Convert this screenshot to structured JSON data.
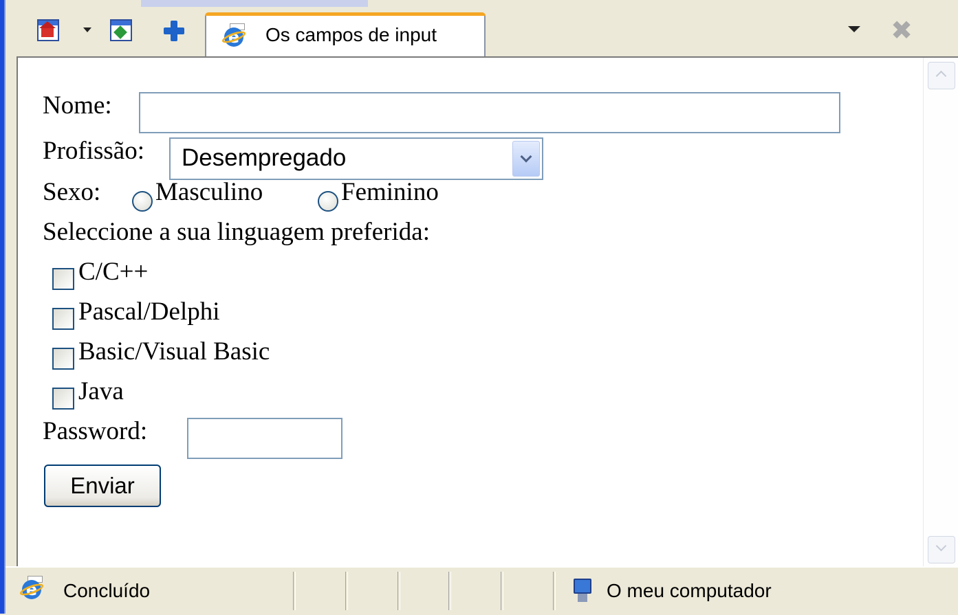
{
  "browser": {
    "tab_title": "Os campos de input"
  },
  "form": {
    "nome_label": "Nome:",
    "nome_value": "",
    "profissao_label": "Profissão:",
    "profissao_selected": "Desempregado",
    "sexo_label": "Sexo:",
    "sexo_options": [
      "Masculino",
      "Feminino"
    ],
    "linguagem_prompt": "Seleccione a sua linguagem preferida:",
    "linguagens": [
      "C/C++",
      "Pascal/Delphi",
      "Basic/Visual Basic",
      "Java"
    ],
    "password_label": "Password:",
    "password_value": "",
    "submit_label": "Enviar"
  },
  "statusbar": {
    "status": "Concluído",
    "zone": "O meu computador"
  },
  "colors": {
    "input_border": "#7f9db9",
    "window_chrome": "#ece9d8",
    "tab_accent": "#f5a623",
    "frame_blue": "#1c4ad8"
  },
  "icons": [
    "home-icon",
    "feeds-icon",
    "add-favorite-icon",
    "ie-page-icon",
    "tab-list-dropdown-icon",
    "close-tab-icon",
    "computer-zone-icon"
  ]
}
